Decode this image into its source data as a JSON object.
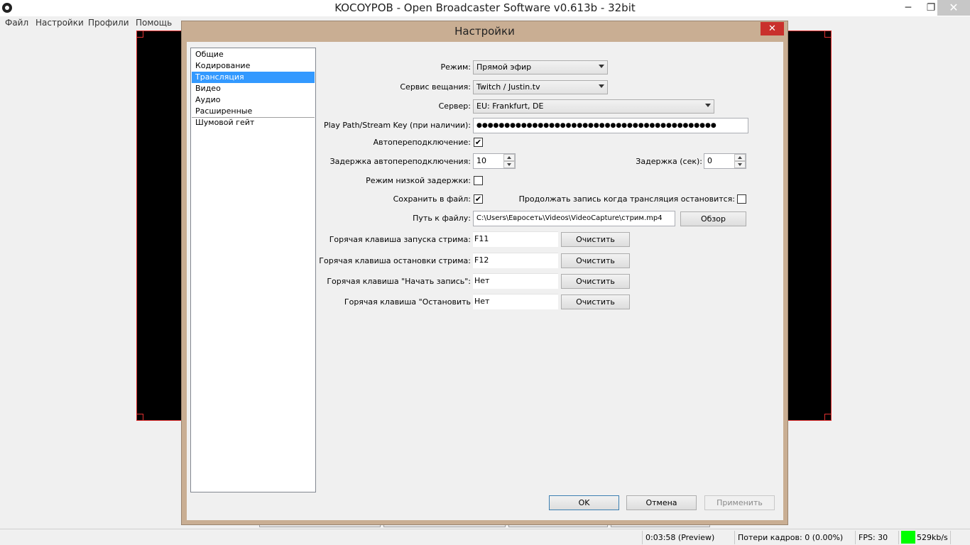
{
  "app": {
    "title": "KOCOYPOB - Open Broadcaster Software v0.613b - 32bit",
    "minimize": "─",
    "maximize": "❐",
    "close": "✕"
  },
  "menu": [
    "Файл",
    "Настройки",
    "Профили",
    "Помощь"
  ],
  "status": {
    "time": "0:03:58 (Preview)",
    "dropped": "Потери кадров: 0 (0.00%)",
    "fps": "FPS: 30",
    "bitrate": "529kb/s",
    "indicator_color": "#00ff00"
  },
  "dialog": {
    "title": "Настройки",
    "close": "✕",
    "categories": [
      "Общие",
      "Кодирование",
      "Трансляция",
      "Видео",
      "Аудио",
      "Расширенные",
      "Шумовой гейт"
    ],
    "selected_category": "Трансляция",
    "fields": {
      "mode_label": "Режим:",
      "mode_value": "Прямой эфир",
      "service_label": "Сервис вещания:",
      "service_value": "Twitch / Justin.tv",
      "server_label": "Сервер:",
      "server_value": "EU: Frankfurt, DE",
      "key_label": "Play Path/Stream Key (при наличии):",
      "key_value": "●●●●●●●●●●●●●●●●●●●●●●●●●●●●●●●●●●●●●●●●●●●",
      "autoreconnect_label": "Автопереподключение:",
      "autoreconnect_mark": "✔",
      "reconnect_delay_label": "Задержка автопереподключения:",
      "reconnect_delay_value": "10",
      "delay_label": "Задержка (сек):",
      "delay_value": "0",
      "low_latency_label": "Режим низкой задержки:",
      "save_file_label": "Сохранить в файл:",
      "save_file_mark": "✔",
      "continue_record_label": "Продолжать запись когда трансляция остановится:",
      "path_label": "Путь к файлу:",
      "path_value": "C:\\Users\\Евросеть\\Videos\\VideoCapture\\стрим.mp4",
      "browse": "Обзор",
      "hk_start_stream_label": "Горячая клавиша запуска стрима:",
      "hk_start_stream_value": "F11",
      "hk_stop_stream_label": "Горячая клавиша остановки стрима:",
      "hk_stop_stream_value": "F12",
      "hk_start_rec_label": "Горячая клавиша \"Начать запись\":",
      "hk_start_rec_value": "Нет",
      "hk_stop_rec_label": "Горячая клавиша \"Остановить",
      "hk_stop_rec_value": "Нет",
      "clear": "Очистить"
    },
    "buttons": {
      "ok": "OK",
      "cancel": "Отмена",
      "apply": "Применить"
    },
    "colors": {
      "frame": "#c9ae93",
      "selection": "#3399ff",
      "close": "#c9302c"
    }
  }
}
